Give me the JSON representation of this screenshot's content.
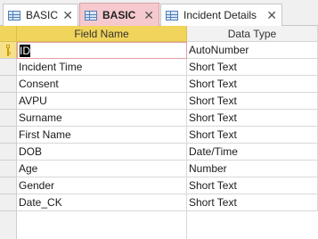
{
  "tabs": [
    {
      "label": "BASIC",
      "active": false,
      "icon": "table-icon"
    },
    {
      "label": "BASIC",
      "active": true,
      "icon": "table-icon"
    },
    {
      "label": "Incident Details",
      "active": false,
      "icon": "table-icon"
    }
  ],
  "columns": {
    "field_name": "Field Name",
    "data_type": "Data Type"
  },
  "rows": [
    {
      "field": "ID",
      "type": "AutoNumber",
      "primary_key": true
    },
    {
      "field": "Incident Time",
      "type": "Short Text"
    },
    {
      "field": "Consent",
      "type": "Short Text"
    },
    {
      "field": "AVPU",
      "type": "Short Text"
    },
    {
      "field": "Surname",
      "type": "Short Text"
    },
    {
      "field": "First Name",
      "type": "Short Text"
    },
    {
      "field": "DOB",
      "type": "Date/Time"
    },
    {
      "field": "Age",
      "type": "Number"
    },
    {
      "field": "Gender",
      "type": "Short Text"
    },
    {
      "field": "Date_CK",
      "type": "Short Text"
    }
  ],
  "colors": {
    "header": "#f1d45b",
    "active_tab": "#f6c9ce",
    "selection": "#e39ea6"
  }
}
